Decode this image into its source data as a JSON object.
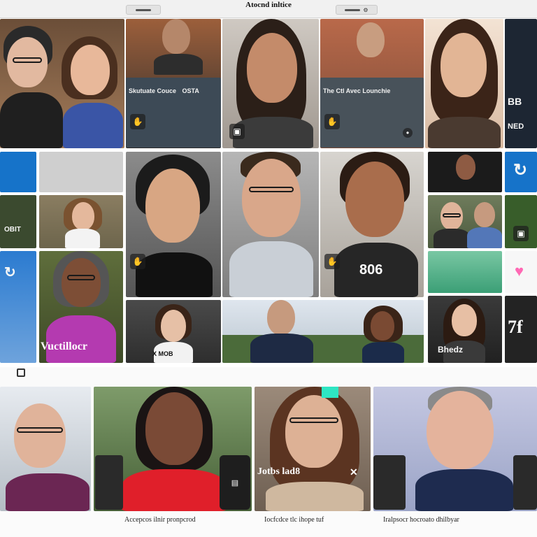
{
  "window": {
    "title": "Atocnd inltice",
    "left_pill": "",
    "right_pill": ""
  },
  "tiles": {
    "t1": {
      "name": "",
      "color_bg": "#8c6a4a"
    },
    "t2": {
      "name": "Skutuate Couce",
      "tag": "OSTA"
    },
    "t3": {
      "name": "The Ctl Avec Lounchie"
    },
    "t4": {
      "name": "BB",
      "tag": "NED"
    },
    "t5": {
      "name": "OBIT"
    },
    "t6": {
      "overlay": "806"
    },
    "t7": {
      "name": "Vuctillocr"
    },
    "t8": {
      "name": "X MOB"
    },
    "t9": {
      "name": "Bhedz"
    },
    "t10": {
      "overlay": "7f"
    }
  },
  "bottom": {
    "tile1": {
      "name": ""
    },
    "tile2": {
      "name": ""
    },
    "tile3": {
      "name": "Jotbs lad8",
      "close": "✕"
    },
    "tile4": {
      "name": ""
    }
  },
  "captions": {
    "c1": "Accepcos ilnir pronpcrod",
    "c2": "Iocfcdce tlc ihope tuf",
    "c3": "Iralpsocr hocroato dhilbyar"
  },
  "icons": {
    "pin": "📌",
    "chat": "💬",
    "heart": "♥",
    "refresh": "↻"
  },
  "colors": {
    "accent_blue": "#1673c9",
    "heart_pink": "#ff69b4",
    "teal_tag": "#2ee6c3"
  }
}
